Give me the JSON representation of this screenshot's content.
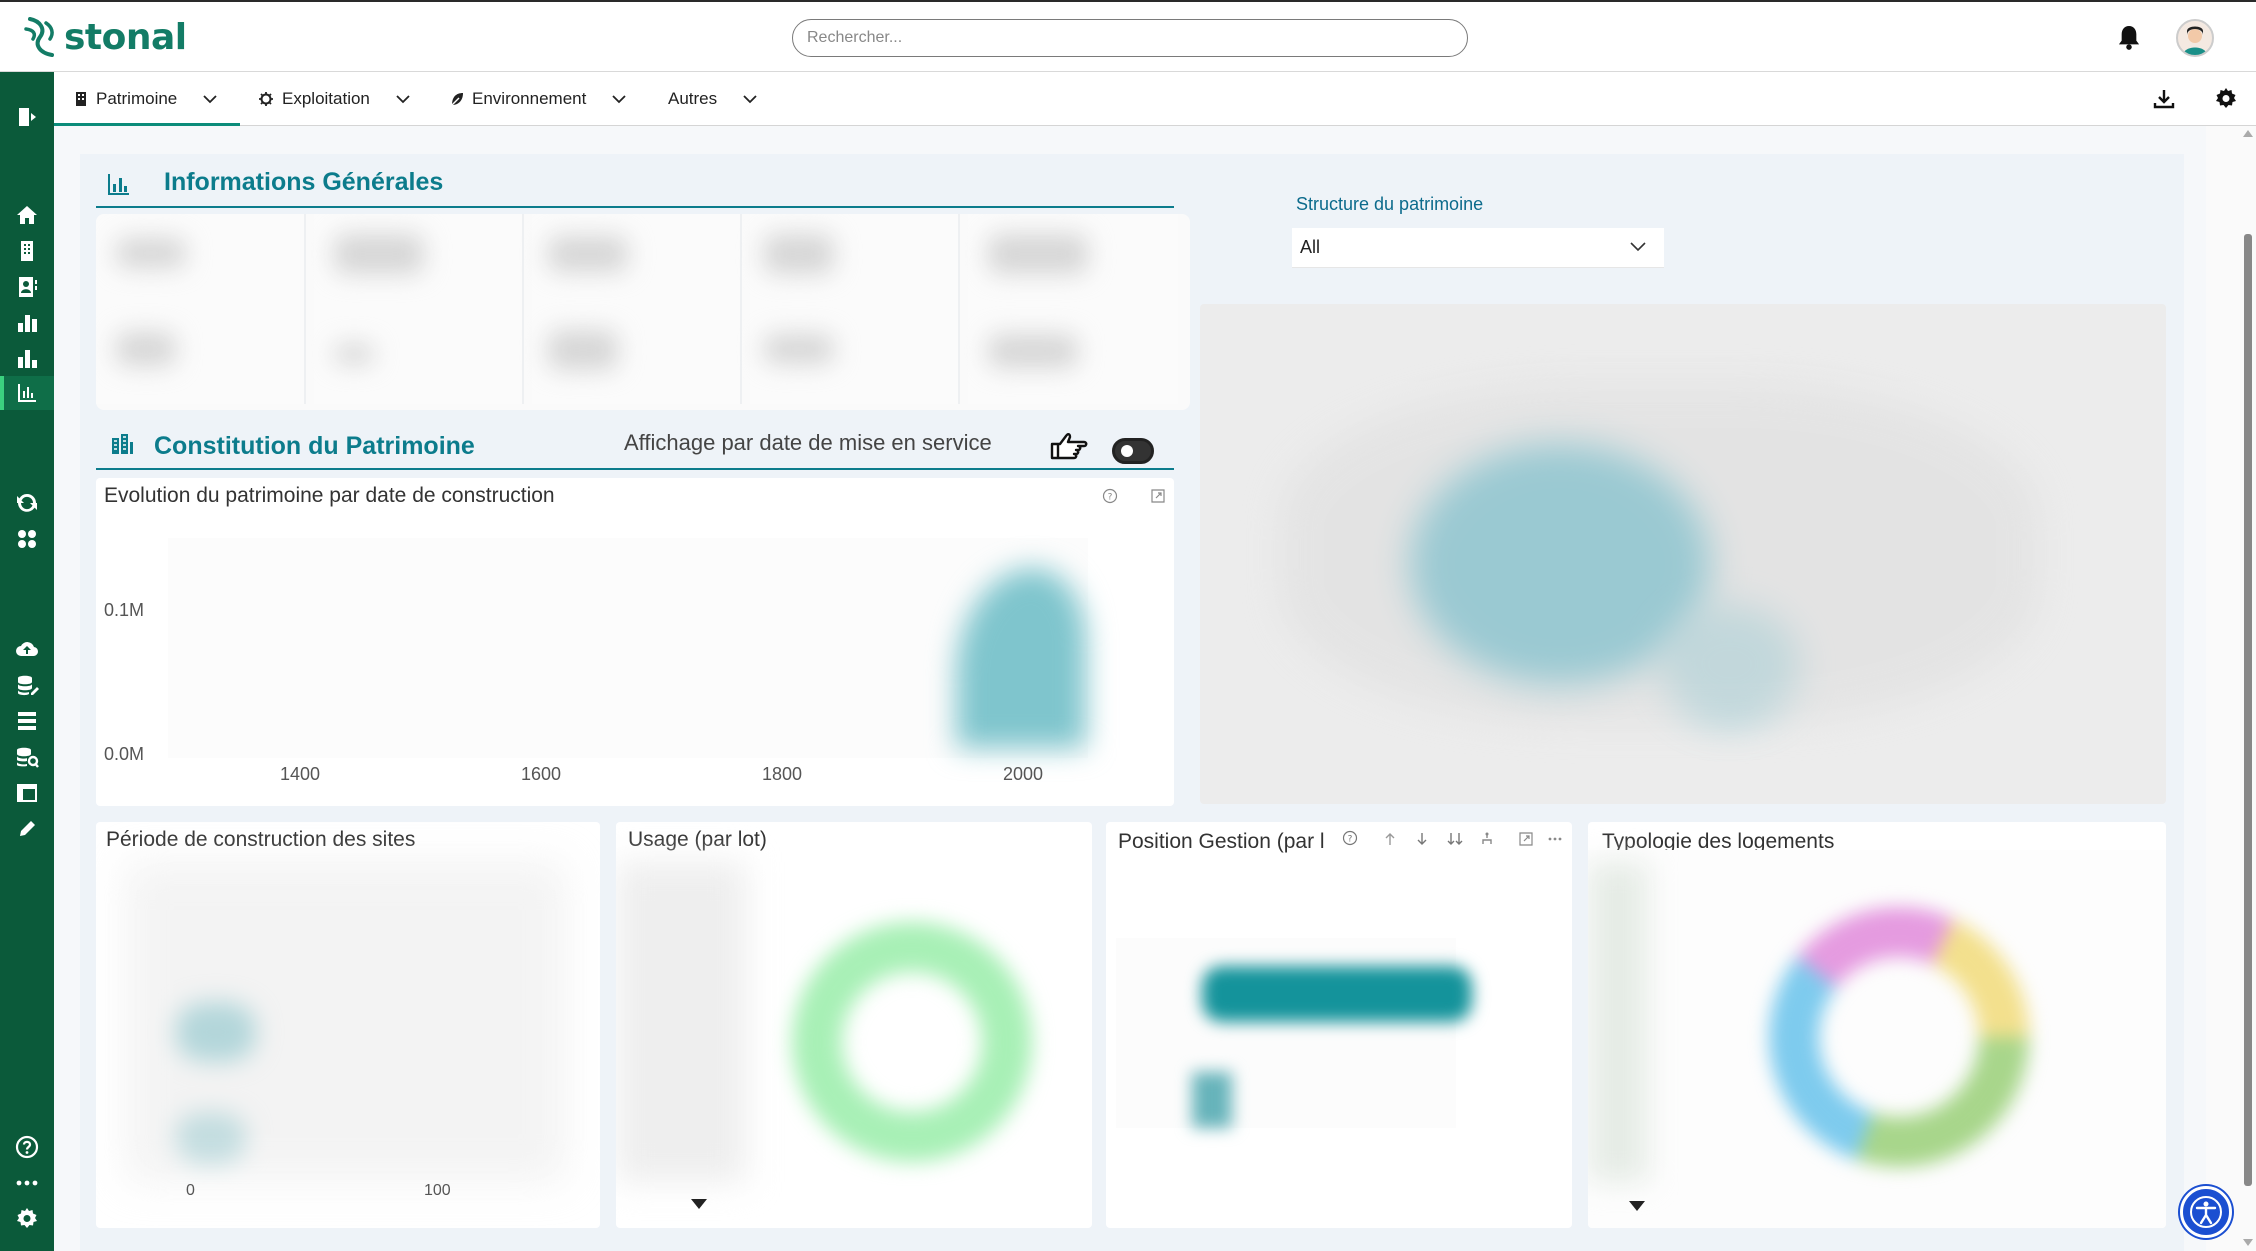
{
  "app": {
    "logo_text": "stonal"
  },
  "search": {
    "placeholder": "Rechercher..."
  },
  "nav": {
    "items": [
      {
        "label": "Patrimoine"
      },
      {
        "label": "Exploitation"
      },
      {
        "label": "Environnement"
      },
      {
        "label": "Autres"
      }
    ]
  },
  "sections": {
    "general": {
      "title": "Informations Générales"
    },
    "constitution": {
      "title": "Constitution du Patrimoine",
      "toggle_label": "Affichage par date de mise en service"
    }
  },
  "filter": {
    "label": "Structure du patrimoine",
    "value": "All"
  },
  "charts": {
    "evolution": {
      "title": "Evolution du patrimoine par date de construction",
      "y_ticks": [
        "0.1M",
        "0.0M"
      ],
      "x_ticks": [
        "1400",
        "1600",
        "1800",
        "2000"
      ]
    },
    "periode": {
      "title": "Période de construction des sites",
      "x_ticks": [
        "0",
        "100"
      ]
    },
    "usage": {
      "title": "Usage (par lot)"
    },
    "position": {
      "title": "Position Gestion (par l"
    },
    "typologie": {
      "title": "Typologie des logements"
    }
  },
  "colors": {
    "brand": "#137c66",
    "sidebar": "#0b5a3a",
    "accent": "#0c7c8c"
  }
}
